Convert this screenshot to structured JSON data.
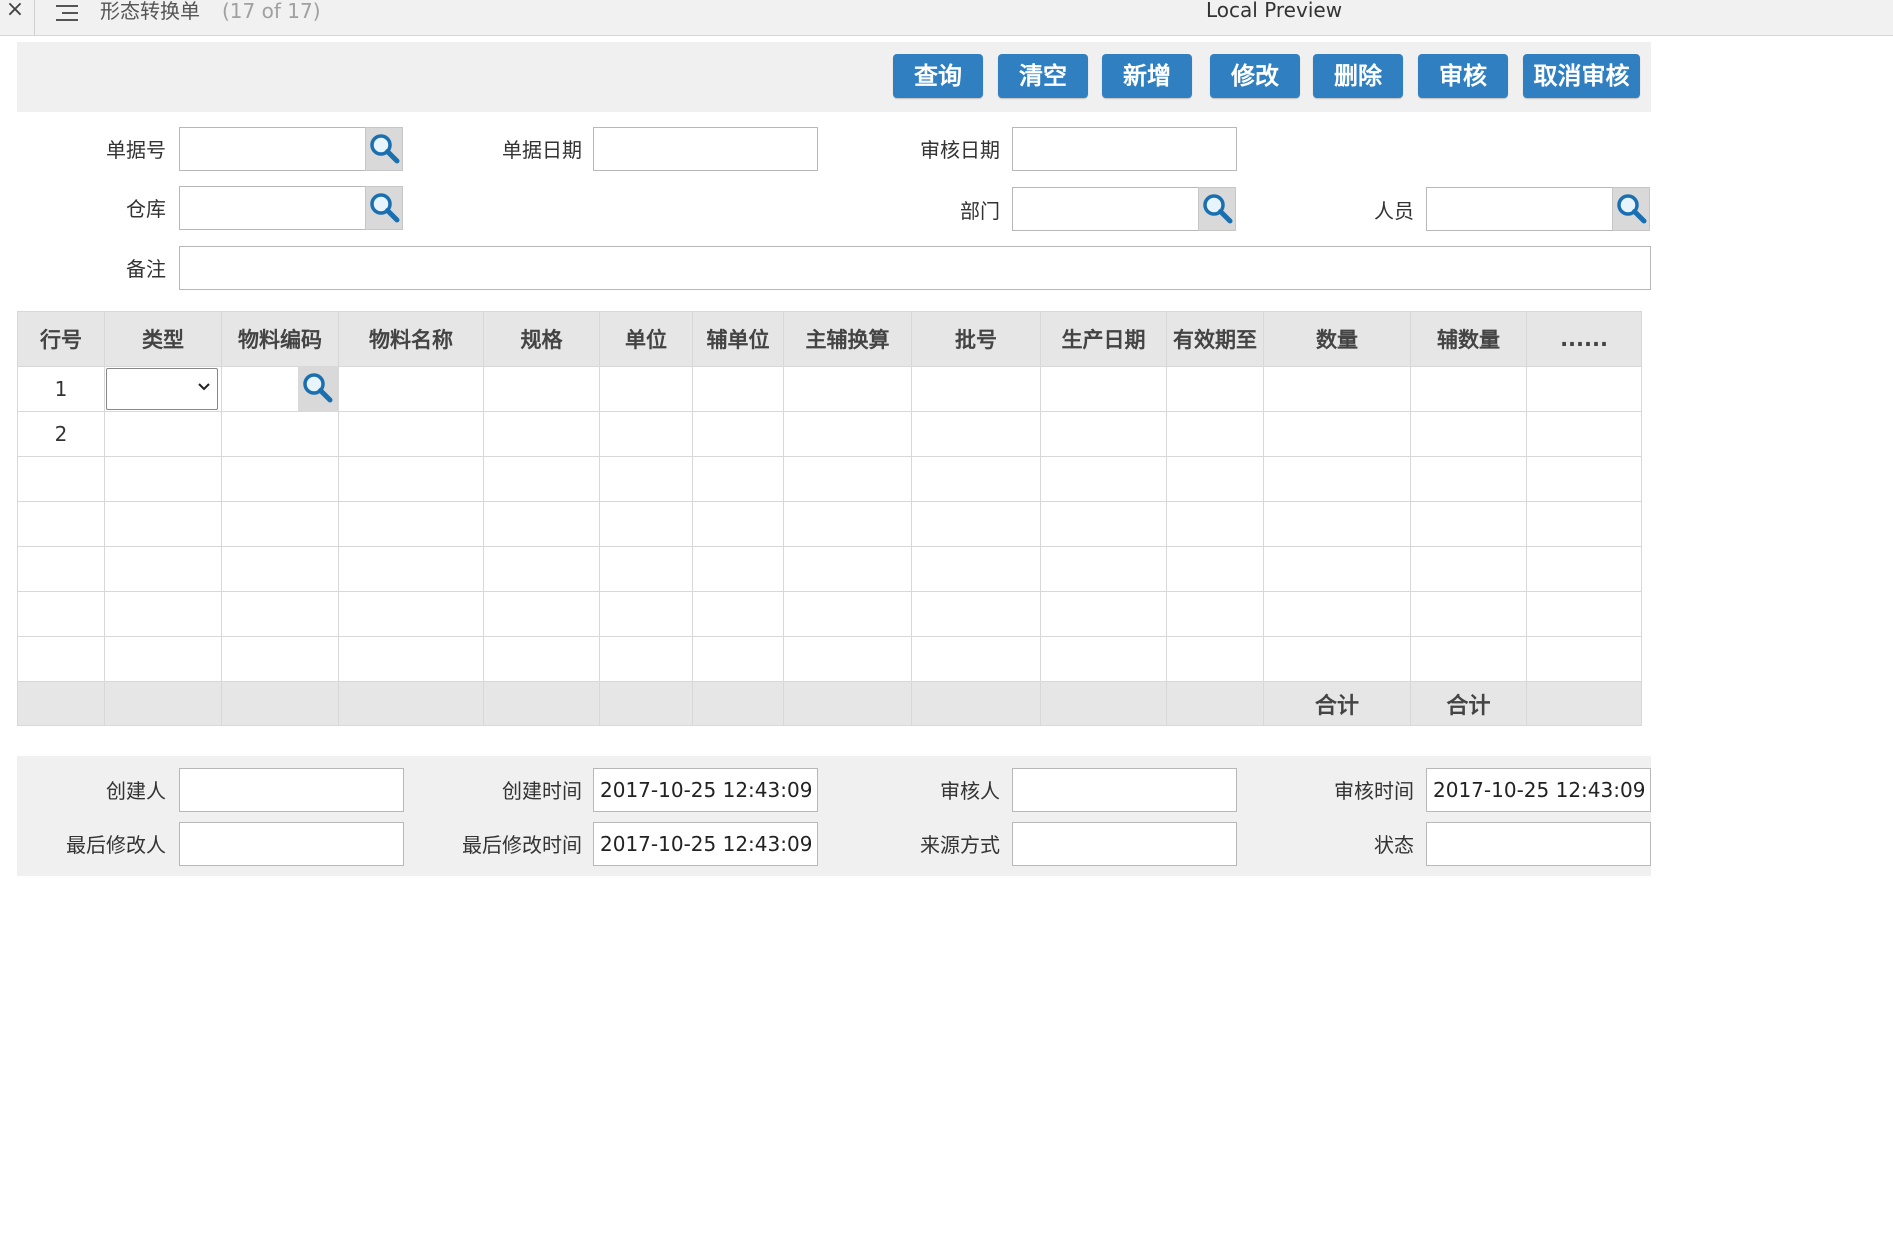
{
  "window": {
    "close_glyph": "×",
    "title": "形态转换单",
    "count": "(17 of 17)",
    "preview_label": "Local Preview"
  },
  "toolbar": {
    "query": "查询",
    "clear": "清空",
    "add": "新增",
    "edit": "修改",
    "delete": "删除",
    "approve": "审核",
    "cancel_approve": "取消审核",
    "button_color": "#2f7fc1"
  },
  "form": {
    "doc_no_label": "单据号",
    "doc_no_value": "",
    "doc_date_label": "单据日期",
    "doc_date_value": "",
    "approve_date_label": "审核日期",
    "approve_date_value": "",
    "warehouse_label": "仓库",
    "warehouse_value": "",
    "department_label": "部门",
    "department_value": "",
    "person_label": "人员",
    "person_value": "",
    "remark_label": "备注",
    "remark_value": ""
  },
  "grid": {
    "columns": [
      "行号",
      "类型",
      "物料编码",
      "物料名称",
      "规格",
      "单位",
      "辅单位",
      "主辅换算",
      "批号",
      "生产日期",
      "有效期至",
      "数量",
      "辅数量",
      "......"
    ],
    "row_numbers": [
      "1",
      "2",
      "",
      "",
      "",
      "",
      ""
    ],
    "qty_total_label": "合计",
    "aux_qty_total_label": "合计"
  },
  "footer": {
    "creator_label": "创建人",
    "creator_value": "",
    "create_time_label": "创建时间",
    "create_time_value": "2017-10-25 12:43:09",
    "approver_label": "审核人",
    "approver_value": "",
    "approve_time_label": "审核时间",
    "approve_time_value": "2017-10-25 12:43:09",
    "last_modifier_label": "最后修改人",
    "last_modifier_value": "",
    "last_modify_time_label": "最后修改时间",
    "last_modify_time_value": "2017-10-25 12:43:09",
    "source_label": "来源方式",
    "source_value": "",
    "status_label": "状态",
    "status_value": ""
  },
  "icons": {
    "search": "search-icon",
    "menu": "hamburger-menu-icon",
    "close": "close-icon",
    "dropdown": "chevron-down-icon"
  }
}
